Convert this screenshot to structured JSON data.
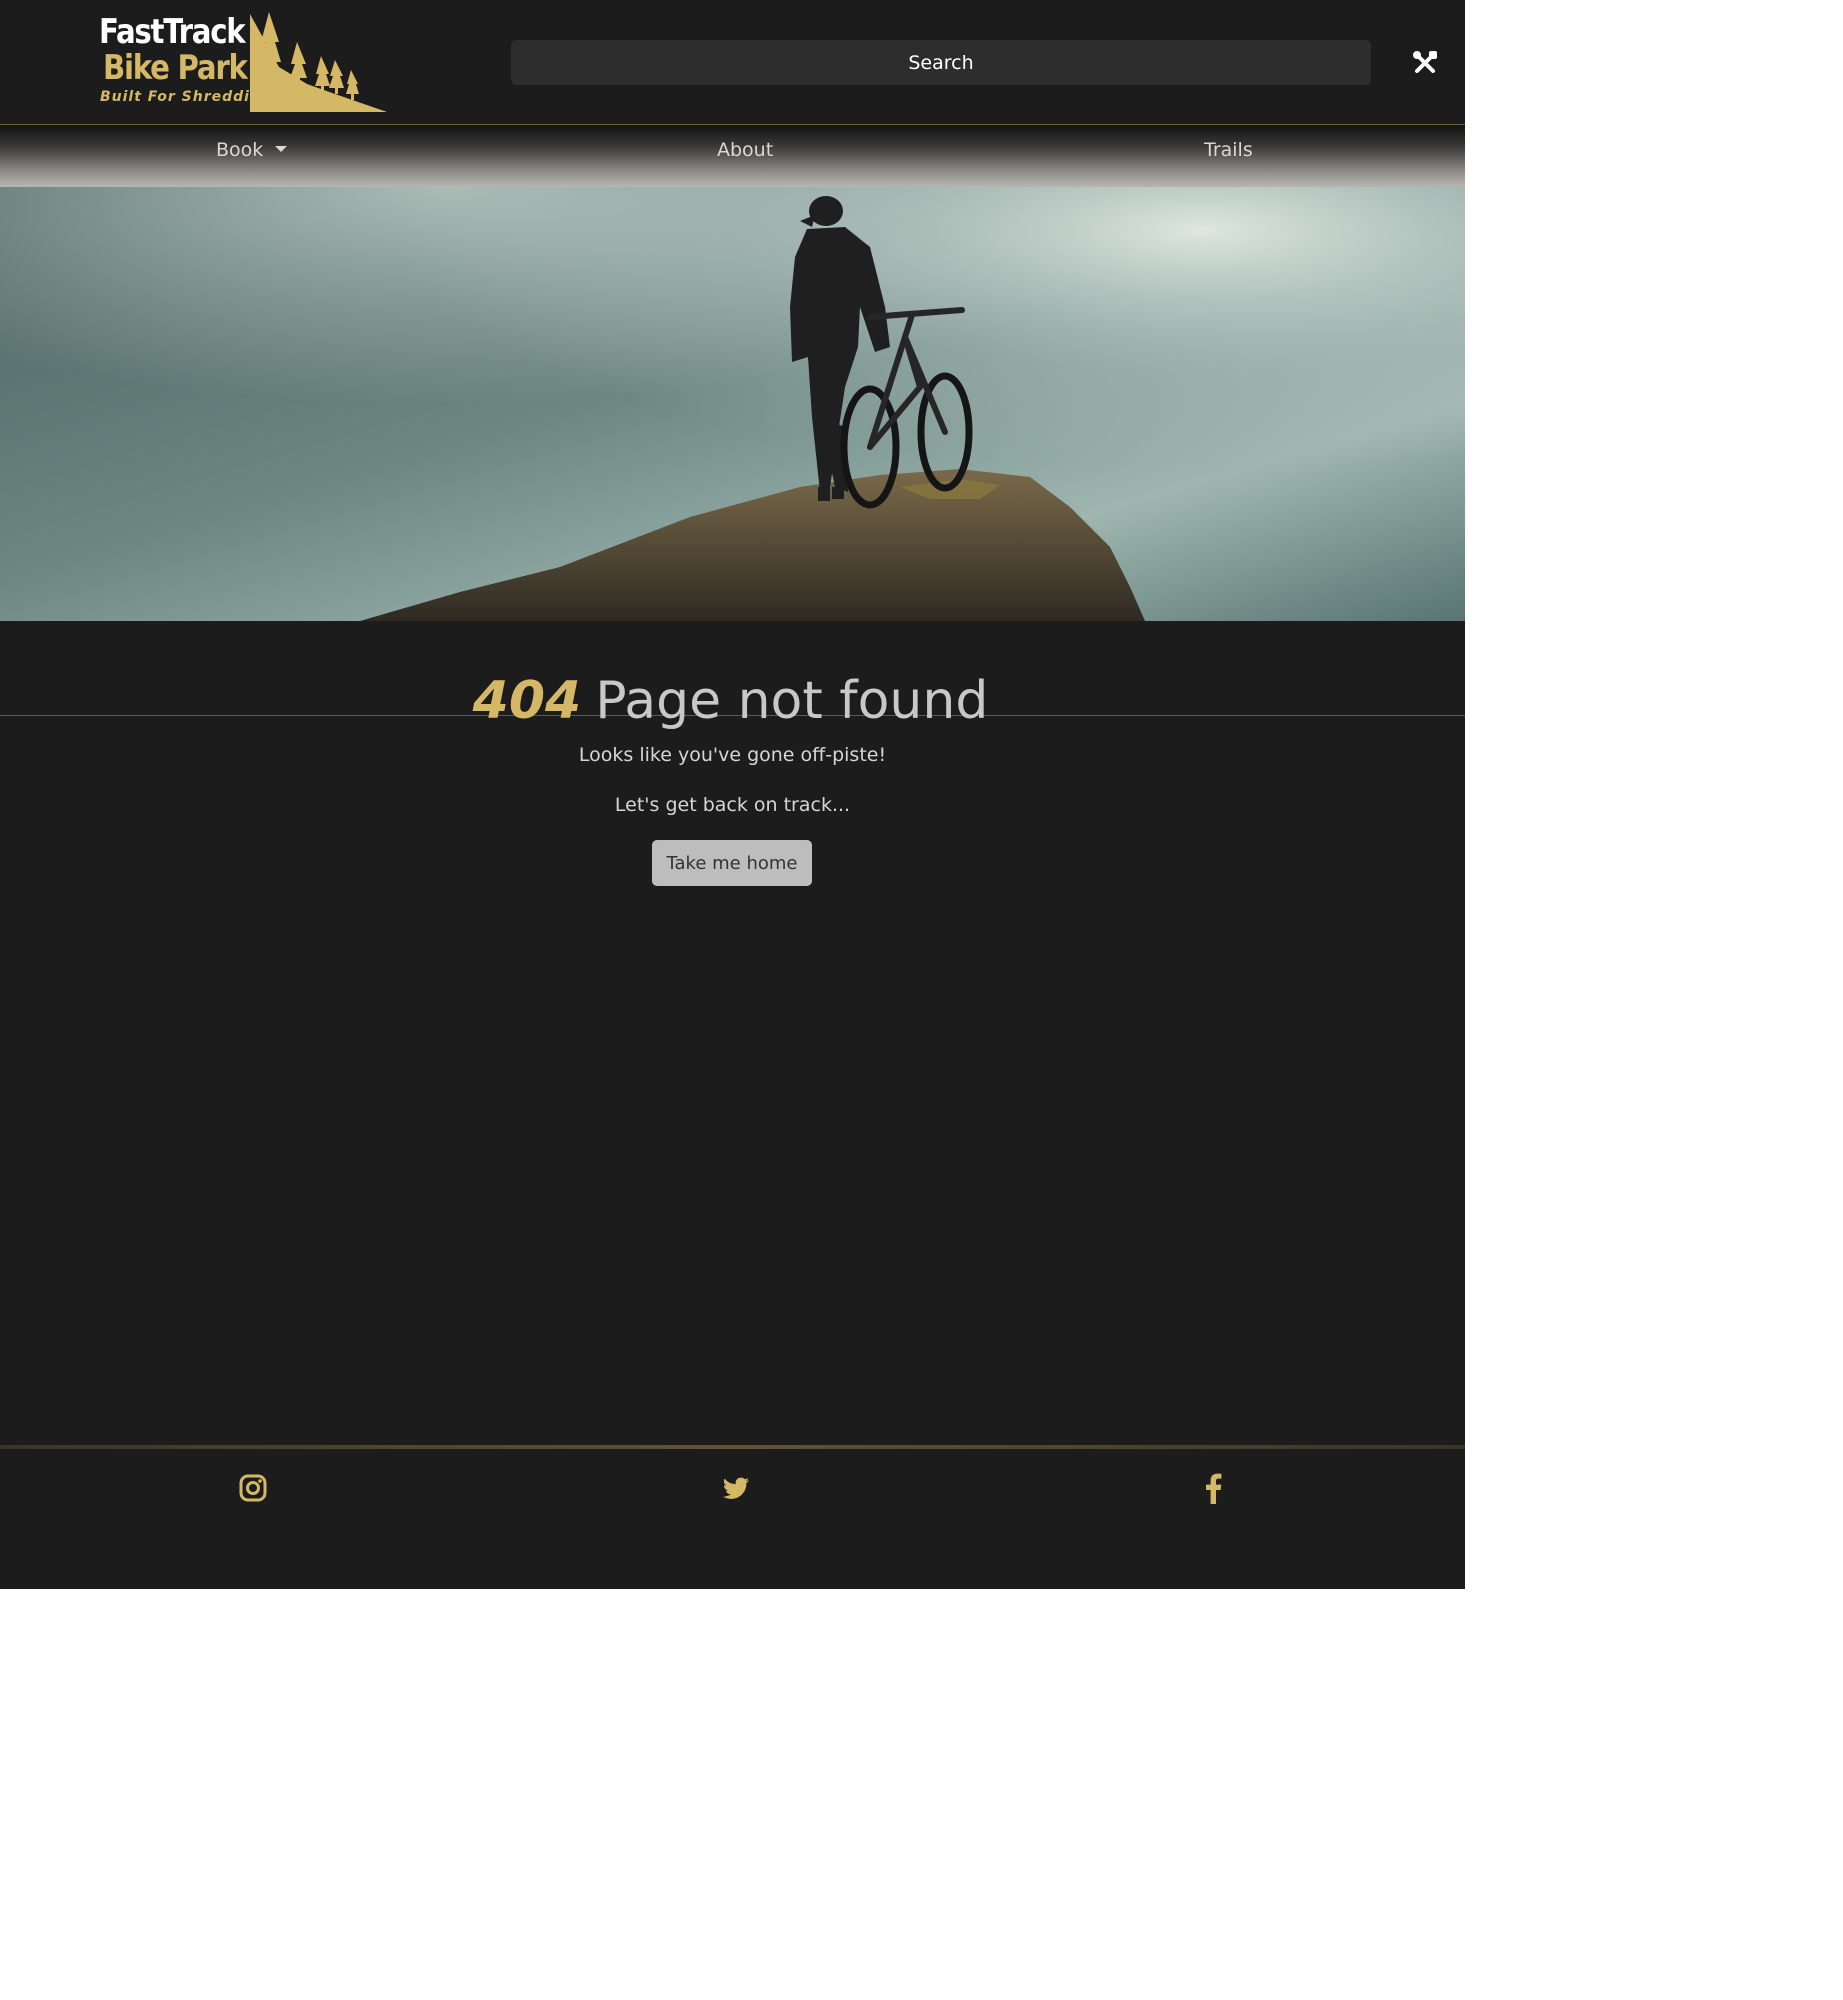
{
  "brand": {
    "line1": "FastTrack",
    "line2": "Bike Park",
    "tagline": "Built For Shredding",
    "accent_color": "#d4b866"
  },
  "header": {
    "search_placeholder": "Search",
    "tools_icon": "wrench-screwdriver-icon"
  },
  "nav": {
    "items": [
      {
        "label": "Book",
        "has_dropdown": true
      },
      {
        "label": "About"
      },
      {
        "label": "Trails"
      }
    ]
  },
  "hero": {
    "description_icon": "mountain-biker-cliff-photo"
  },
  "error": {
    "code": "404",
    "title": "Page not found",
    "message1": "Looks like you've gone off-piste!",
    "message2": "Let's get back on track...",
    "button_label": "Take me home"
  },
  "footer": {
    "social": [
      "instagram-icon",
      "twitter-icon",
      "facebook-icon"
    ]
  },
  "colors": {
    "background": "#1c1c1c",
    "accent": "#d4b866",
    "button": "#bdbdbd"
  }
}
